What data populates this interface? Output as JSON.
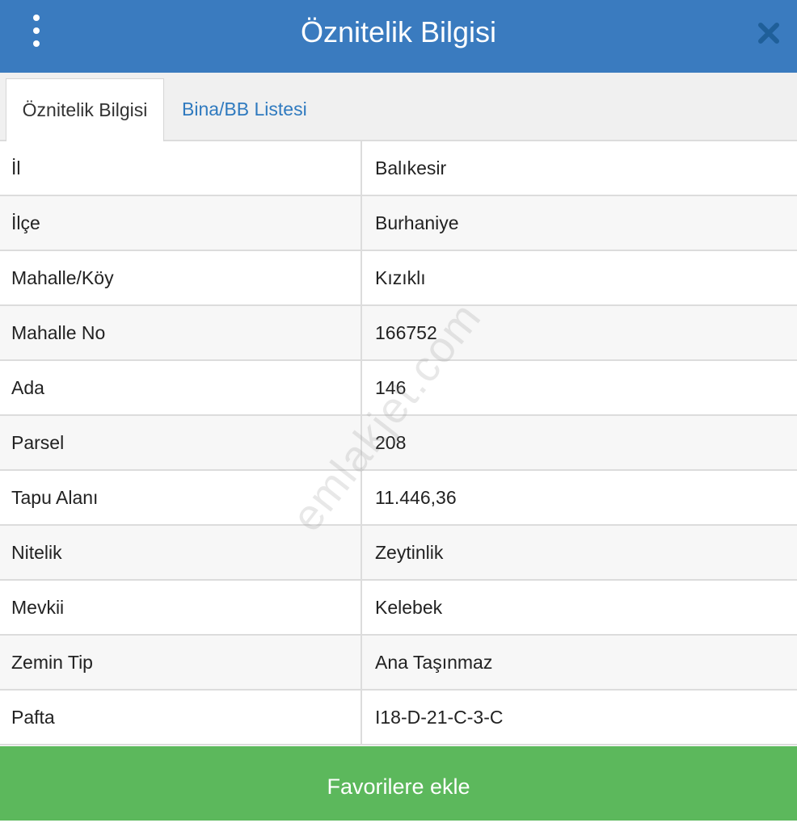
{
  "header": {
    "title": "Öznitelik Bilgisi",
    "menu_icon": "vertical-dots-icon",
    "close_icon": "close-x-icon",
    "color": "#3a7bbf"
  },
  "tabs": [
    {
      "label": "Öznitelik Bilgisi",
      "active": true
    },
    {
      "label": "Bina/BB Listesi",
      "active": false
    }
  ],
  "attributes": [
    {
      "label": "İl",
      "value": "Balıkesir"
    },
    {
      "label": "İlçe",
      "value": "Burhaniye"
    },
    {
      "label": "Mahalle/Köy",
      "value": "Kızıklı"
    },
    {
      "label": "Mahalle No",
      "value": "166752"
    },
    {
      "label": "Ada",
      "value": "146"
    },
    {
      "label": "Parsel",
      "value": "208"
    },
    {
      "label": "Tapu Alanı",
      "value": "11.446,36"
    },
    {
      "label": "Nitelik",
      "value": "Zeytinlik"
    },
    {
      "label": "Mevkii",
      "value": "Kelebek"
    },
    {
      "label": "Zemin Tip",
      "value": "Ana Taşınmaz"
    },
    {
      "label": "Pafta",
      "value": "I18-D-21-C-3-C"
    }
  ],
  "watermark": "emlakjet.com",
  "footer": {
    "favorite_label": "Favorilere ekle",
    "color": "#5cb85c"
  }
}
